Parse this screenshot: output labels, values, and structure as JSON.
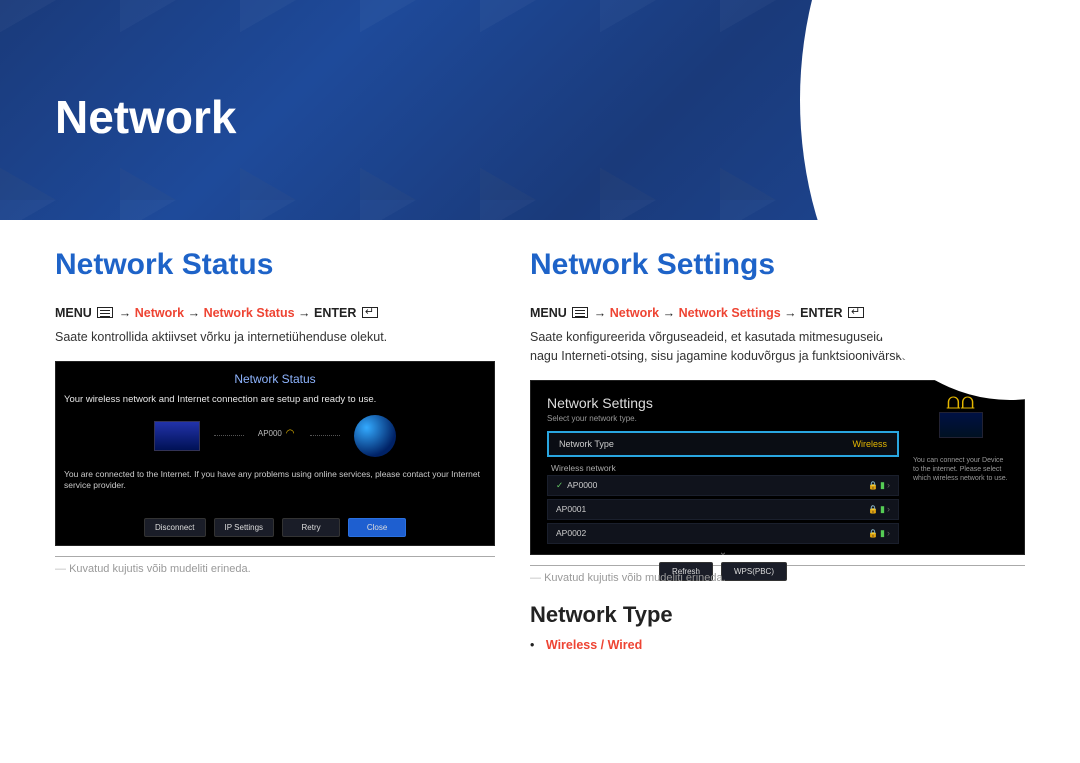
{
  "header": {
    "title": "Network"
  },
  "left": {
    "heading": "Network Status",
    "nav": {
      "menu": "MENU",
      "arrow": "→",
      "seg1": "Network",
      "seg2": "Network Status",
      "enter": "ENTER"
    },
    "desc": "Saate kontrollida aktiivset võrku ja internetiühenduse olekut.",
    "ss": {
      "title": "Network Status",
      "msg": "Your wireless network and Internet connection are setup and ready to use.",
      "ap": "AP000",
      "note": "You are connected to the Internet. If you have any problems using online services, please contact your Internet service provider.",
      "buttons": [
        "Disconnect",
        "IP Settings",
        "Retry",
        "Close"
      ]
    },
    "caption": "Kuvatud kujutis võib mudeliti erineda."
  },
  "right": {
    "heading": "Network Settings",
    "nav": {
      "menu": "MENU",
      "arrow": "→",
      "seg1": "Network",
      "seg2": "Network Settings",
      "enter": "ENTER"
    },
    "desc": "Saate konfigureerida võrguseadeid, et kasutada mitmesuguseid Smart Hubi funktsioone, nagu Interneti-otsing, sisu jagamine koduvõrgus ja funktsioonivärskendused.",
    "ss": {
      "title": "Network Settings",
      "sub": "Select your network type.",
      "field_label": "Network Type",
      "field_value": "Wireless",
      "wlabel": "Wireless network",
      "aps": [
        "AP0000",
        "AP0001",
        "AP0002"
      ],
      "btn_refresh": "Refresh",
      "btn_wps": "WPS(PBC)",
      "side_text": "You can connect your Device to the internet. Please select which wireless network to use."
    },
    "caption": "Kuvatud kujutis võib mudeliti erineda.",
    "type_heading": "Network Type",
    "type_opt1": "Wireless",
    "type_sep": " / ",
    "type_opt2": "Wired"
  }
}
